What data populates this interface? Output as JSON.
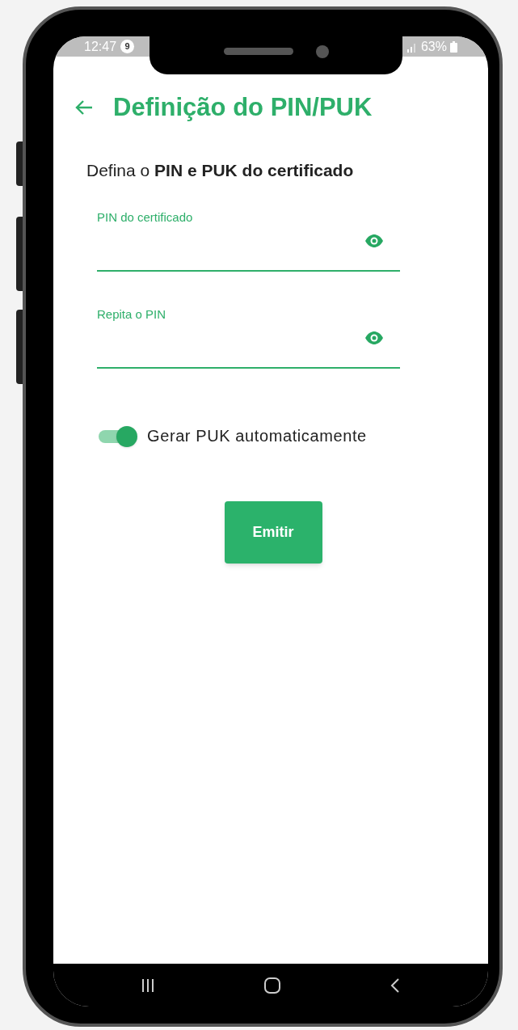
{
  "status_bar": {
    "time": "12:47",
    "notification_count": "9",
    "battery": "63%"
  },
  "header": {
    "title": "Definição do PIN/PUK"
  },
  "subtitle": "Defina o **PIN e PUK do certificado**",
  "fields": [
    {
      "label": "PIN do certificado"
    },
    {
      "label": "Repita o PIN"
    }
  ],
  "toggle": {
    "label": "Gerar PUK automaticamente",
    "on": true
  },
  "buttons": [
    "Emitir"
  ]
}
